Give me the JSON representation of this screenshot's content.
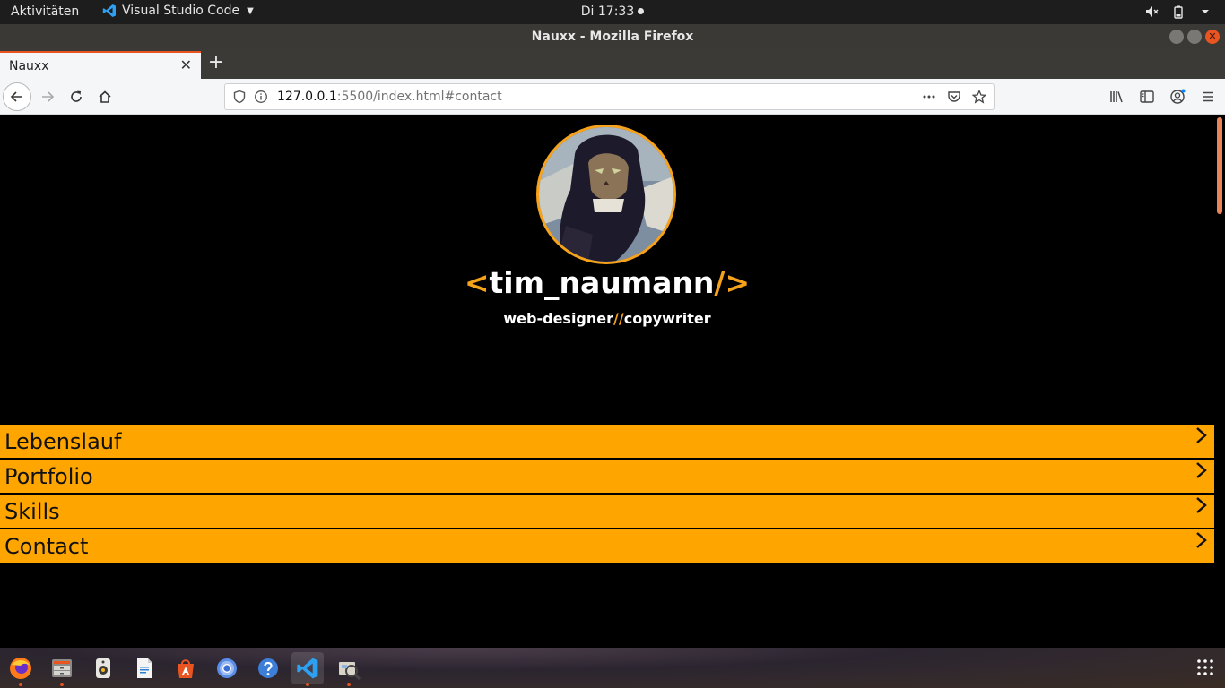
{
  "gnome": {
    "activities": "Aktivitäten",
    "app_name": "Visual Studio Code",
    "clock": "Di 17:33"
  },
  "window": {
    "title": "Nauxx - Mozilla Firefox"
  },
  "tabs": [
    {
      "label": "Nauxx"
    }
  ],
  "url": {
    "host": "127.0.0.1",
    "rest": ":5500/index.html#contact"
  },
  "site": {
    "title_open": "<",
    "title_name": "tim_naumann",
    "title_close": "/>",
    "subtitle_a": "web-designer",
    "subtitle_sep": "//",
    "subtitle_b": "copywriter"
  },
  "menu": [
    {
      "label": "Lebenslauf"
    },
    {
      "label": "Portfolio"
    },
    {
      "label": "Skills"
    },
    {
      "label": "Contact"
    }
  ],
  "colors": {
    "accent": "#f7a21b",
    "menu_bg": "#ffa500",
    "page_bg": "#000000"
  }
}
